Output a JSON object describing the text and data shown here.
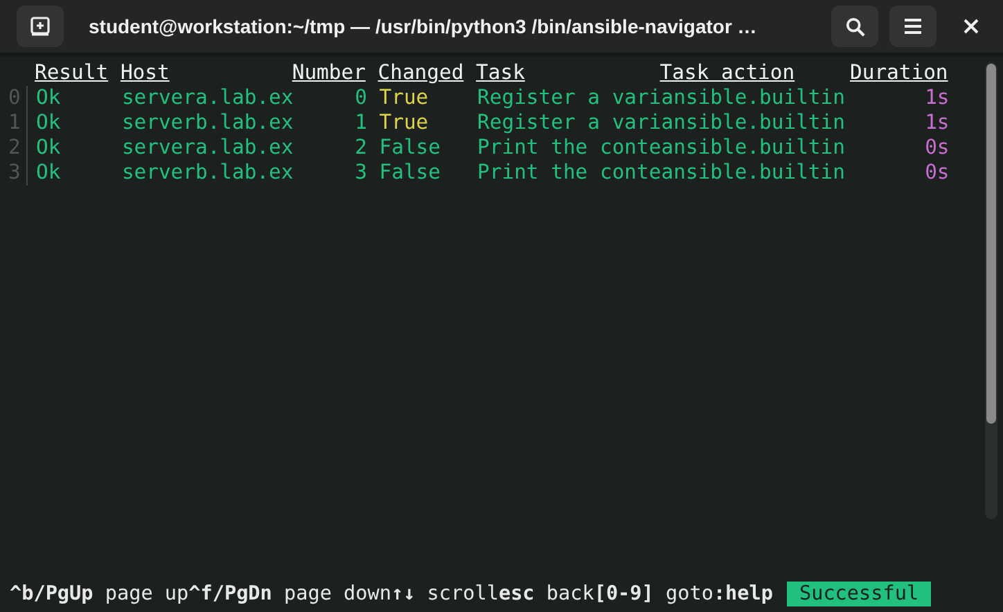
{
  "window": {
    "title": "student@workstation:~/tmp — /usr/bin/python3 /bin/ansible-navigator …"
  },
  "table": {
    "columns": [
      "Result",
      "Host",
      "Number",
      "Changed",
      "Task",
      "Task action",
      "Duration"
    ],
    "rows": [
      {
        "index": "0",
        "result": "Ok",
        "host": "servera.lab.ex",
        "number": "0",
        "changed": "True",
        "color": "#dcd34a",
        "task": "Register a vari",
        "task_action": "ansible.builtin",
        "duration": "1s"
      },
      {
        "index": "1",
        "result": "Ok",
        "host": "serverb.lab.ex",
        "number": "1",
        "changed": "True",
        "color": "#dcd34a",
        "task": "Register a vari",
        "task_action": "ansible.builtin",
        "duration": "1s"
      },
      {
        "index": "2",
        "result": "Ok",
        "host": "servera.lab.ex",
        "number": "2",
        "changed": "False",
        "color": "#22c07e",
        "task": "Print the conte",
        "task_action": "ansible.builtin",
        "duration": "0s"
      },
      {
        "index": "3",
        "result": "Ok",
        "host": "serverb.lab.ex",
        "number": "3",
        "changed": "False",
        "color": "#22c07e",
        "task": "Print the conte",
        "task_action": "ansible.builtin",
        "duration": "0s"
      }
    ]
  },
  "footer": {
    "keys": [
      {
        "key": "^b/PgUp",
        "label": " page up"
      },
      {
        "key": "^f/PgDn",
        "label": " page down"
      },
      {
        "key": "↑↓",
        "label": " scroll"
      },
      {
        "key": "esc",
        "label": " back"
      },
      {
        "key": "[0-9]",
        "label": " goto"
      },
      {
        "key": ":help"
      }
    ],
    "status": "Successful"
  }
}
